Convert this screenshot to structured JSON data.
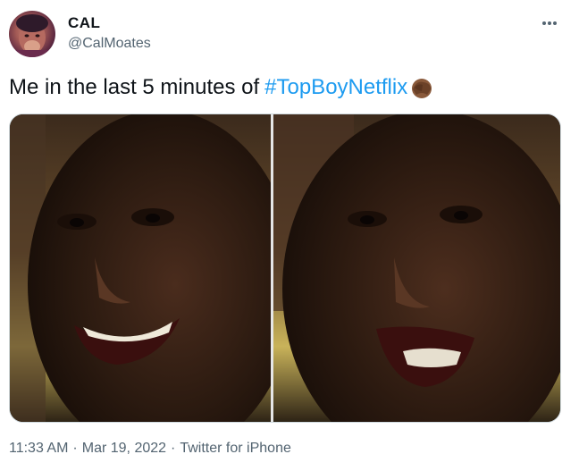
{
  "tweet": {
    "author": {
      "display_name": "CAL",
      "handle": "@CalMoates"
    },
    "text": "Me in the last 5 minutes of",
    "hashtag": "#TopBoyNetflix",
    "emoji": "face-palm-emoji",
    "time": "11:33 AM",
    "separator": "·",
    "date": "Mar 19, 2022",
    "source": "Twitter for iPhone"
  },
  "icons": {
    "more": "more-horizontal-icon",
    "avatar": "avatar"
  },
  "colors": {
    "link": "#1d9bf0",
    "secondary_text": "#536471",
    "primary_text": "#0f1419",
    "media_border": "#cfd9de"
  }
}
